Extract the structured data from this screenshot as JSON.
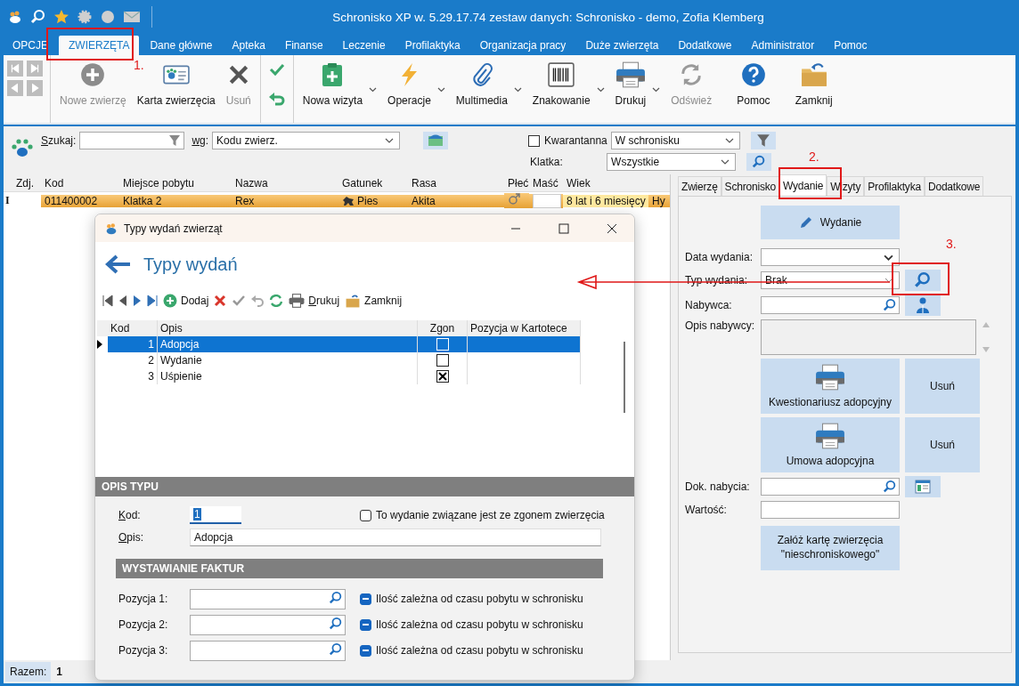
{
  "window": {
    "title": "Schronisko XP w. 5.29.17.74 zestaw danych: Schronisko - demo, Zofia Klemberg"
  },
  "menu_tabs": [
    {
      "label": "OPCJE",
      "selected": false
    },
    {
      "label": "ZWIERZĘTA",
      "selected": true
    },
    {
      "label": "Dane główne",
      "selected": false
    },
    {
      "label": "Apteka",
      "selected": false
    },
    {
      "label": "Finanse",
      "selected": false
    },
    {
      "label": "Leczenie",
      "selected": false
    },
    {
      "label": "Profilaktyka",
      "selected": false
    },
    {
      "label": "Organizacja pracy",
      "selected": false
    },
    {
      "label": "Duże zwierzęta",
      "selected": false
    },
    {
      "label": "Dodatkowe",
      "selected": false
    },
    {
      "label": "Administrator",
      "selected": false
    },
    {
      "label": "Pomoc",
      "selected": false
    }
  ],
  "ribbon": {
    "record_buttons": [
      {
        "kind": "plus",
        "label": "Nowe zwierzę",
        "disabled": true
      },
      {
        "kind": "card",
        "label": "Karta zwierzęcia",
        "disabled": false
      },
      {
        "kind": "cross",
        "label": "Usuń",
        "disabled": true
      }
    ],
    "main_buttons": [
      {
        "kind": "clipboard",
        "label": "Nowa wizyta",
        "disabled": false,
        "dropdown": true
      },
      {
        "kind": "lightning",
        "label": "Operacje",
        "disabled": false,
        "dropdown": true
      },
      {
        "kind": "paperclip",
        "label": "Multimedia",
        "disabled": false,
        "dropdown": true
      },
      {
        "kind": "barcode",
        "label": "Znakowanie",
        "disabled": false,
        "dropdown": true
      },
      {
        "kind": "printer",
        "label": "Drukuj",
        "disabled": false,
        "dropdown": true
      },
      {
        "kind": "refresh",
        "label": "Odśwież",
        "disabled": true,
        "dropdown": false
      },
      {
        "kind": "help",
        "label": "Pomoc",
        "disabled": false,
        "dropdown": false
      },
      {
        "kind": "folder",
        "label": "Zamknij",
        "disabled": false,
        "dropdown": false
      }
    ]
  },
  "search": {
    "label": "Szukaj:",
    "by_label": "wg:",
    "by_value": "Kodu zwierz.",
    "quarantine": {
      "label": "Kwarantanna",
      "checked": false
    },
    "location": "W schronisku",
    "cage_label": "Klatka:",
    "cage": "Wszystkie"
  },
  "table": {
    "columns": [
      "Zdj.",
      "Kod",
      "Miejsce pobytu",
      "Nazwa",
      "Gatunek",
      "Rasa",
      "Płeć",
      "Maść",
      "Wiek"
    ],
    "rows": [
      {
        "selected": true,
        "marker": "I",
        "kod": "011400002",
        "miejsce": "Klatka 2",
        "nazwa": "Rex",
        "gatunek": "Pies",
        "rasa": "Akita",
        "wiek": "8 lat i 6 miesięcy",
        "column_10": "Hy"
      }
    ]
  },
  "status_bar": {
    "label": "Razem:",
    "count": "1"
  },
  "detail_tabs": [
    {
      "label": "Zwierzę",
      "selected": false
    },
    {
      "label": "Schronisko",
      "selected": false
    },
    {
      "label": "Wydanie",
      "selected": true
    },
    {
      "label": "Wizyty",
      "selected": false
    },
    {
      "label": "Profilaktyka",
      "selected": false
    },
    {
      "label": "Dodatkowe",
      "selected": false
    }
  ],
  "issue_panel": {
    "issue_button": "Wydanie",
    "date_label": "Data wydania:",
    "type_label": "Typ wydania:",
    "type_value": "Brak",
    "buyer_label": "Nabywca:",
    "buyer_desc_label": "Opis nabywcy:",
    "documents": [
      {
        "label": "Kwestionariusz adopcyjny",
        "delete": "Usuń"
      },
      {
        "label": "Umowa adopcyjna",
        "delete": "Usuń"
      }
    ],
    "doc_label": "Dok. nabycia:",
    "value_label": "Wartość:",
    "create_card_button": "Załóż kartę zwierzęcia \"nieschroniskowego\""
  },
  "dialog": {
    "title": "Typy wydań zwierząt",
    "heading": "Typy wydań",
    "add": "Dodaj",
    "print": "Drukuj",
    "close": "Zamknij",
    "columns": [
      "Kod",
      "Opis",
      "Zgon",
      "Pozycja w Kartotece"
    ],
    "rows": [
      {
        "kod": "1",
        "opis": "Adopcja",
        "zgon": false,
        "selected": true
      },
      {
        "kod": "2",
        "opis": "Wydanie",
        "zgon": false,
        "selected": false
      },
      {
        "kod": "3",
        "opis": "Uśpienie",
        "zgon": true,
        "selected": false
      }
    ],
    "section_title": "OPIS TYPU",
    "kod_label": "Kod:",
    "kod_value": "1",
    "death_checkbox": {
      "label": "To wydanie związane jest ze zgonem zwierzęcia",
      "checked": false
    },
    "opis_label": "Opis:",
    "opis_value": "Adopcja",
    "invoice_title": "WYSTAWIANIE FAKTUR",
    "positions": [
      {
        "label": "Pozycja 1:",
        "option": "Ilość zależna od czasu pobytu w schronisku",
        "indeterminate": true
      },
      {
        "label": "Pozycja 2:",
        "option": "Ilość zależna od czasu pobytu w schronisku",
        "indeterminate": true
      },
      {
        "label": "Pozycja 3:",
        "option": "Ilość zależna od czasu pobytu w schronisku",
        "indeterminate": true
      }
    ]
  },
  "annotations": [
    {
      "label": "1."
    },
    {
      "label": "2."
    },
    {
      "label": "3."
    }
  ]
}
